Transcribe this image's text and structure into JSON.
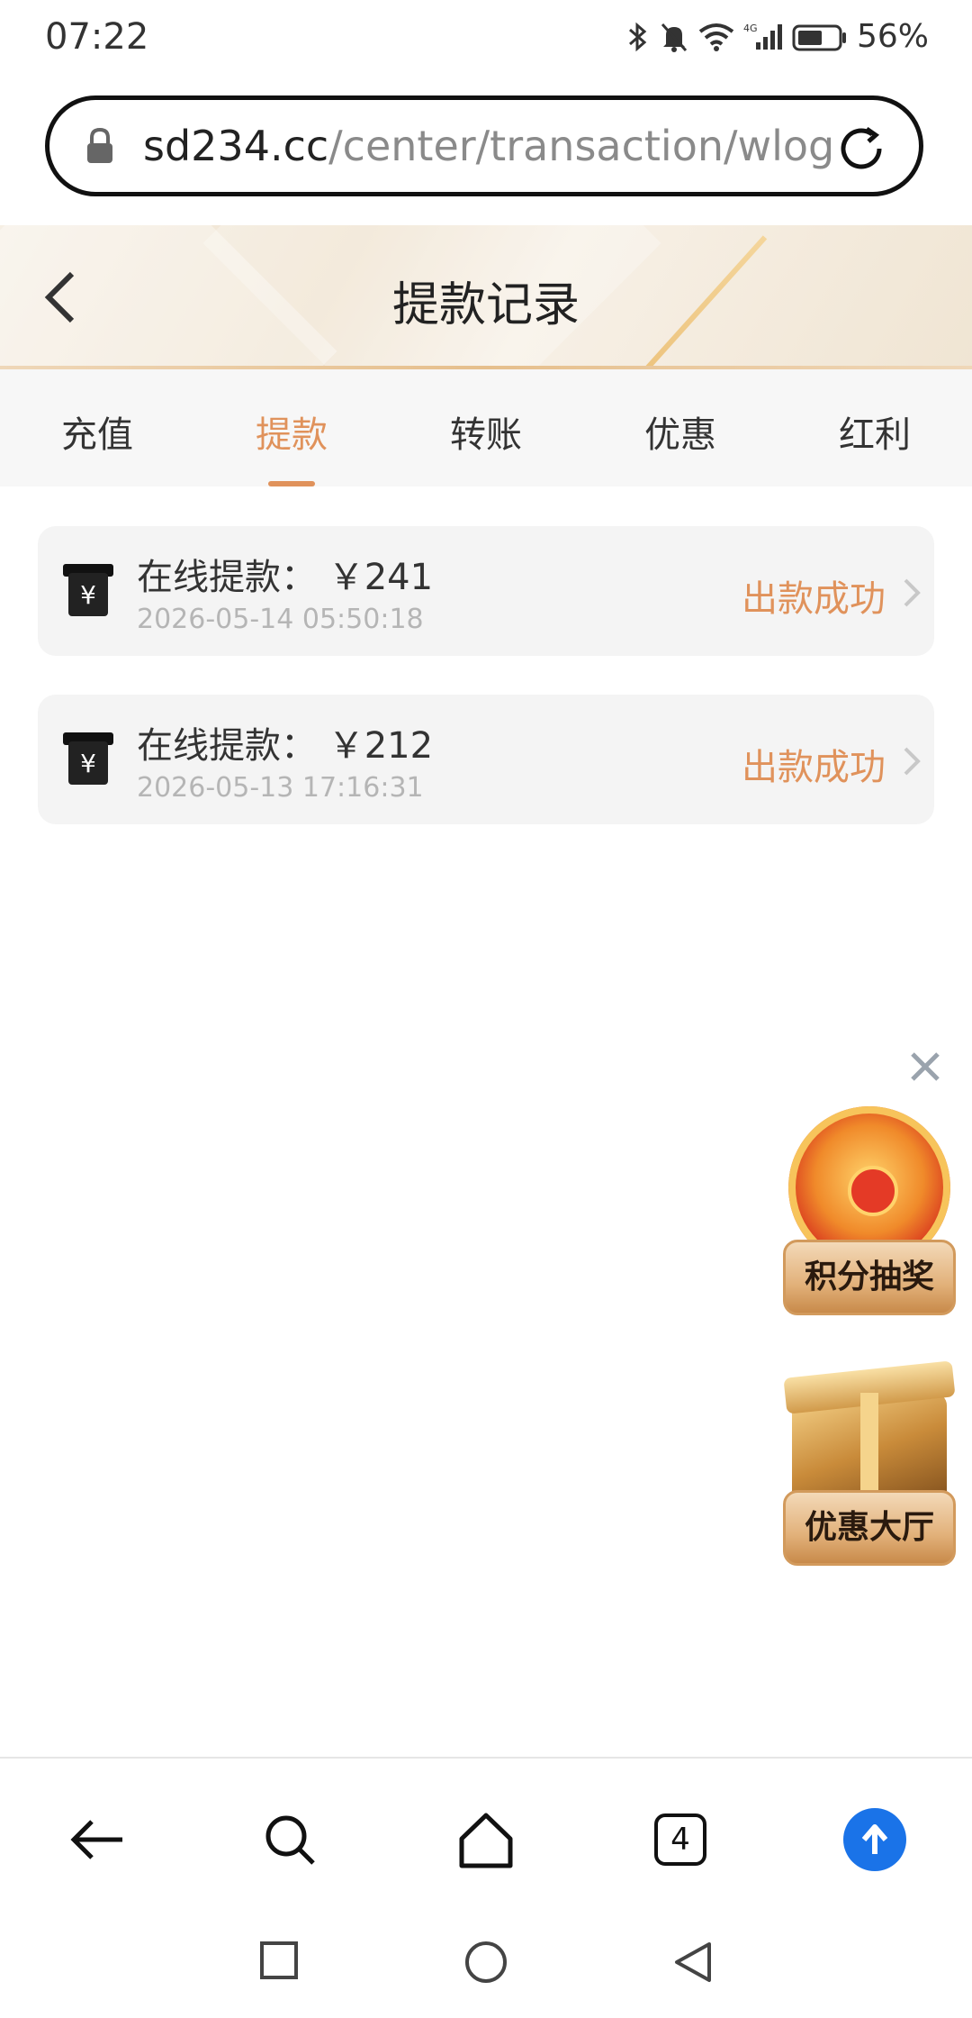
{
  "status_bar": {
    "time": "07:22",
    "battery": "56%",
    "network": "4G"
  },
  "url_bar": {
    "host": "sd234.cc",
    "path": "/center/transaction/wlog"
  },
  "header": {
    "title": "提款记录"
  },
  "tabs": [
    {
      "label": "充值",
      "active": false
    },
    {
      "label": "提款",
      "active": true
    },
    {
      "label": "转账",
      "active": false
    },
    {
      "label": "优惠",
      "active": false
    },
    {
      "label": "红利",
      "active": false
    }
  ],
  "records": [
    {
      "title": "在线提款： ￥241",
      "time": "2026-05-14 05:50:18",
      "status": "出款成功"
    },
    {
      "title": "在线提款： ￥212",
      "time": "2026-05-13 17:16:31",
      "status": "出款成功"
    }
  ],
  "promos": [
    {
      "label": "积分抽奖",
      "icon": "lucky-wheel"
    },
    {
      "label": "优惠大厅",
      "icon": "gift-box"
    }
  ],
  "toolbar": {
    "tab_count": "4"
  },
  "colors": {
    "accent": "#e0925b",
    "upload_blue": "#1a73e8"
  }
}
